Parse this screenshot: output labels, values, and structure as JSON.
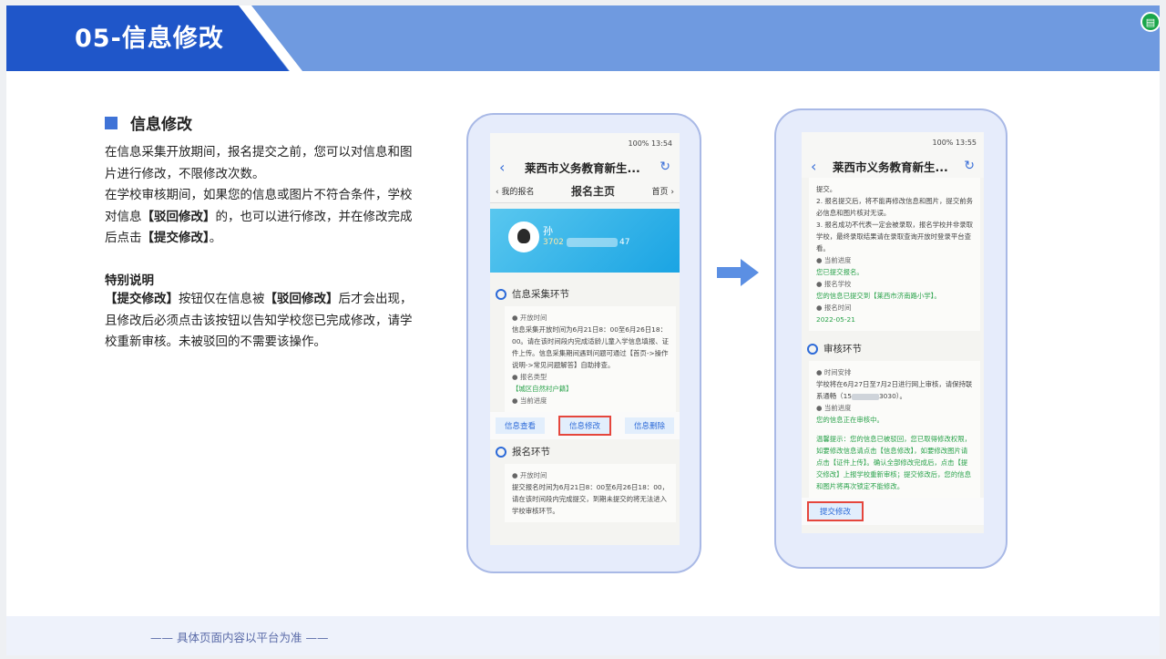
{
  "header": {
    "title": "05-信息修改",
    "corner_icon": "slides-icon"
  },
  "section": {
    "title": "信息修改"
  },
  "desc": {
    "p1": "在信息采集开放期间，报名提交之前，您可以对信息和图片进行修改，不限修改次数。",
    "p2_a": "在学校审核期间，如果您的信息或图片不符合条件，学校对信息",
    "p2_b": "【驳回修改】",
    "p2_c": "的，也可以进行修改，并在修改完成后点击",
    "p2_d": "【提交修改】",
    "p2_e": "。"
  },
  "note": {
    "title": "特别说明",
    "a": "【提交修改】",
    "b": "按钮仅在信息被",
    "c": "【驳回修改】",
    "d": "后才会出现，且修改后必须点击该按钮以告知学校您已完成修改，请学校重新审核。未被驳回的不需要该操作。"
  },
  "phone1": {
    "status": "100% 13:54",
    "title": "莱西市义务教育新生...",
    "nav_left": "我的报名",
    "nav_mid": "报名主页",
    "nav_right": "首页",
    "user_name": "孙",
    "user_id_start": "3702",
    "user_id_end": "47",
    "sec1": "信息采集环节",
    "s1_lbl1": "开放时间",
    "s1_txt1": "信息采集开放时间为6月21日8：00至6月26日18：00。请在该时间段内完成适龄儿童入学信息填报、证件上传。信息采集期间遇到问题可通过【首页->操作说明->常见问题解答】自助排查。",
    "s1_lbl2": "报名类型",
    "s1_val2": "【城区自然村户籍】",
    "s1_lbl3": "当前进度",
    "btn1": "信息查看",
    "btn2": "信息修改",
    "btn3": "信息删除",
    "sec2": "报名环节",
    "s2_lbl1": "开放时间",
    "s2_txt1": "提交报名时间为6月21日8：00至6月26日18：00，请在该时间段内完成提交，到期未提交的将无法进入学校审核环节。"
  },
  "phone2": {
    "status": "100% 13:55",
    "title": "莱西市义务教育新生...",
    "t0": "提交。",
    "t1": "2. 报名提交后，将不能再修改信息和图片，提交前务必信息和图片核对无误。",
    "t2": "3. 报名成功不代表一定会被录取，报名学校并非录取学校，最终录取结果请在录取查询开放时登录平台查看。",
    "lbl1": "当前进度",
    "val1": "您已提交报名。",
    "lbl2": "报名学校",
    "val2": "您的信息已提交到【莱西市济南路小学】。",
    "lbl3": "报名时间",
    "val3": "2022-05-21",
    "sec": "审核环节",
    "lbl4": "时间安排",
    "txt4a": "学校将在6月27日至7月2日进行网上审核，请保持联系通畅（15",
    "txt4b": "3030）。",
    "lbl5": "当前进度",
    "val5": "您的信息正在审核中。",
    "tip": "温馨提示：您的信息已被驳回，您已取得修改权限，如要修改信息请点击【信息修改】，如要修改图片请点击【证件上传】。确认全部修改完成后，点击【提交修改】上报学校重新审核；提交修改后，您的信息和图片将再次锁定不能修改。",
    "btn": "提交修改"
  },
  "footer": {
    "text": "—— 具体页面内容以平台为准 ——"
  },
  "colors": {
    "banner": "#6f9ae0",
    "banner_dark": "#1f56c9",
    "accent": "#3f73d7",
    "highlight": "#e5463d",
    "green": "#29a24a"
  }
}
